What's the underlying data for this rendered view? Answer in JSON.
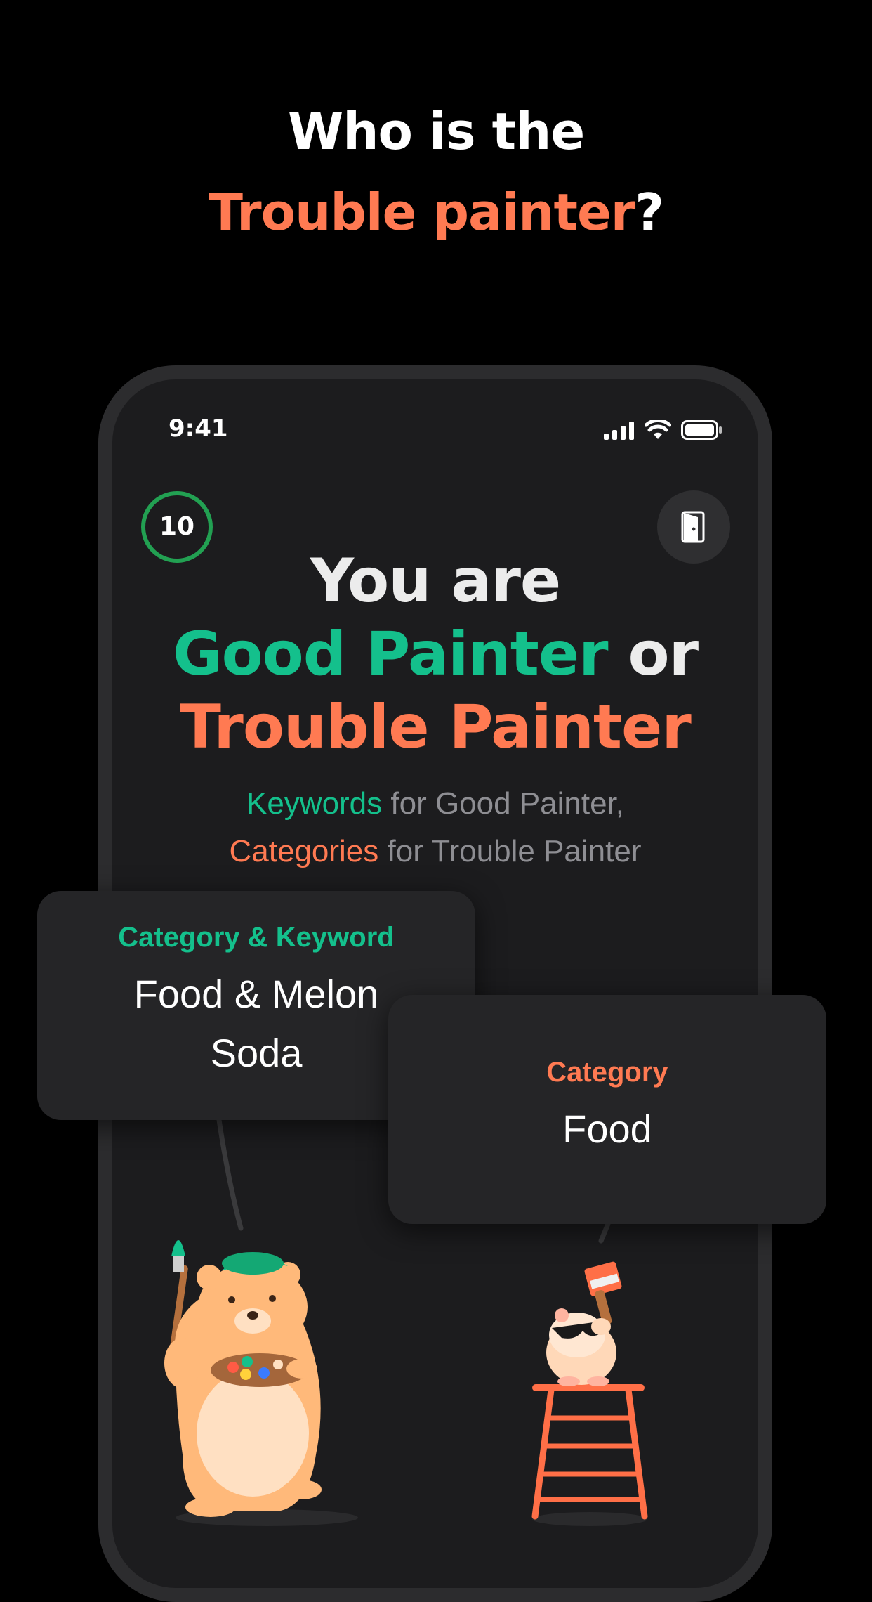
{
  "hero": {
    "line1": "Who is the",
    "accent": "Trouble painter",
    "suffix": "?"
  },
  "status_bar": {
    "time": "9:41",
    "icons": [
      "signal-icon",
      "wifi-icon",
      "battery-icon"
    ]
  },
  "timer": {
    "value": "10"
  },
  "exit_button": {
    "icon": "door-exit-icon"
  },
  "role": {
    "line1": "You are",
    "good": "Good Painter",
    "or": " or",
    "trouble": "Trouble Painter"
  },
  "subtitle": {
    "keywords": "Keywords",
    "keywords_rest": " for Good Painter,",
    "categories": "Categories",
    "categories_rest": " for Trouble Painter"
  },
  "card_good": {
    "label": "Category & Keyword",
    "value": "Food & Melon Soda"
  },
  "card_trouble": {
    "label": "Category",
    "value": "Food"
  },
  "colors": {
    "green": "#14c08c",
    "orange": "#ff7a52",
    "background": "#000000",
    "phone": "#1c1c1e"
  }
}
